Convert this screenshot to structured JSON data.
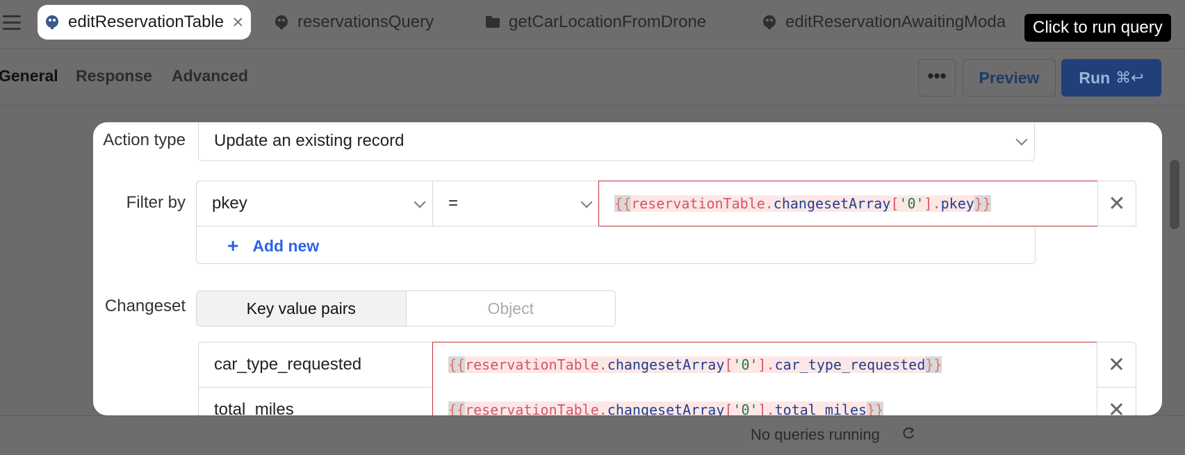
{
  "tabs": [
    {
      "label": "editReservationTable",
      "icon": "postgres-icon",
      "active": true
    },
    {
      "label": "reservationsQuery",
      "icon": "postgres-icon"
    },
    {
      "label": "getCarLocationFromDrone",
      "icon": "folder-icon"
    },
    {
      "label": "editReservationAwaitingModa",
      "icon": "postgres-icon"
    }
  ],
  "tooltip": "Click to run query",
  "subtabs": [
    "General",
    "Response",
    "Advanced"
  ],
  "toolbar": {
    "more": "•••",
    "preview": "Preview",
    "run": "Run",
    "run_shortcut": "⌘↩"
  },
  "form": {
    "action_type_label": "Action type",
    "action_type_value": "Update an existing record",
    "filter_label": "Filter by",
    "filter": {
      "column": "pkey",
      "operator": "=",
      "value_parts": {
        "open": "{{",
        "obj": "reservationTable",
        "dot1": ".",
        "prop": "changesetArray",
        "b1": "[",
        "str": "'0'",
        "b2": "]",
        "dot2": ".",
        "key": "pkey",
        "close": "}}"
      }
    },
    "add_new_label": "Add new",
    "changeset_label": "Changeset",
    "changeset_modes": [
      "Key value pairs",
      "Object"
    ],
    "rows": [
      {
        "column": "car_type_requested",
        "key": "car_type_requested"
      },
      {
        "column": "total_miles",
        "key": "total_miles"
      }
    ]
  },
  "status": {
    "text": "No queries running"
  },
  "colors": {
    "accent": "#2f63e3",
    "error_border": "#c1313c",
    "run_button": "#21407a"
  }
}
